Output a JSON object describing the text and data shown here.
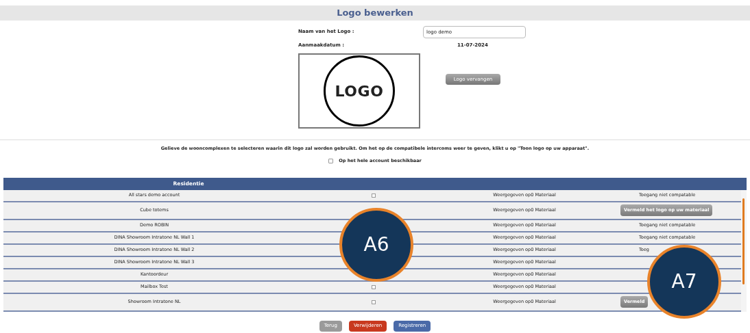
{
  "title": "Logo bewerken",
  "form": {
    "name_label": "Naam van het Logo :",
    "name_value": "logo demo",
    "date_label": "Aanmaakdatum :",
    "date_value": "11-07-2024",
    "logo_text": "LOGO",
    "replace_button": "Logo vervangen"
  },
  "instruction": "Gelieve de wooncomplexen te selecteren waarin dit logo zal worden gebruikt. Om het op de compatibele intercoms weer te geven, klikt u op \"Toon logo op uw apparaat\".",
  "account_option": {
    "label": "Op het hele account beschikbaar",
    "checked": false
  },
  "table": {
    "columns": [
      "Residentie"
    ],
    "rows": [
      {
        "name": "All stars demo account",
        "checkbox": {
          "checked": false
        },
        "display": "Weergegeven op0 Materiaal",
        "access": {
          "kind": "text",
          "label": "Toegang niet compatable"
        }
      },
      {
        "name": "Cube totems",
        "display": "Weergegeven op0 Materiaal",
        "access": {
          "kind": "button",
          "label": "Vermeld het logo op uw materiaal"
        }
      },
      {
        "name": "Demo ROBIN",
        "display": "Weergegeven op0 Materiaal",
        "access": {
          "kind": "text",
          "label": "Toegang niet compatable"
        }
      },
      {
        "name": "DINA Showroom Intratone NL Wall 1",
        "display": "Weergegeven op0 Materiaal",
        "access": {
          "kind": "text",
          "label": "Toegang niet compatable"
        }
      },
      {
        "name": "DINA Showroom Intratone NL Wall 2",
        "display": "Weergegeven op0 Materiaal",
        "access": {
          "kind": "text",
          "label": "Toeg"
        }
      },
      {
        "name": "DINA Showroom Intratone NL Wall 3",
        "display": "Weergegeven op0 Materiaal"
      },
      {
        "name": "Kantoordeur",
        "display": "Weergegeven op0 Materiaal"
      },
      {
        "name": "Mailbox Test",
        "checkbox": {
          "checked": false
        },
        "display": "Weergegeven op0 Materiaal"
      },
      {
        "name": "Showroom Intratone NL",
        "checkbox": {
          "checked": false
        },
        "display": "Weergegeven op0 Materiaal",
        "access": {
          "kind": "button",
          "label": "Vermeld"
        }
      }
    ]
  },
  "buttons": [
    {
      "label": "Terug",
      "kind": "back"
    },
    {
      "label": "Verwijderen",
      "kind": "delete"
    },
    {
      "label": "Registreren",
      "kind": "save"
    }
  ],
  "callouts": [
    {
      "label": "A6"
    },
    {
      "label": "A7"
    }
  ]
}
